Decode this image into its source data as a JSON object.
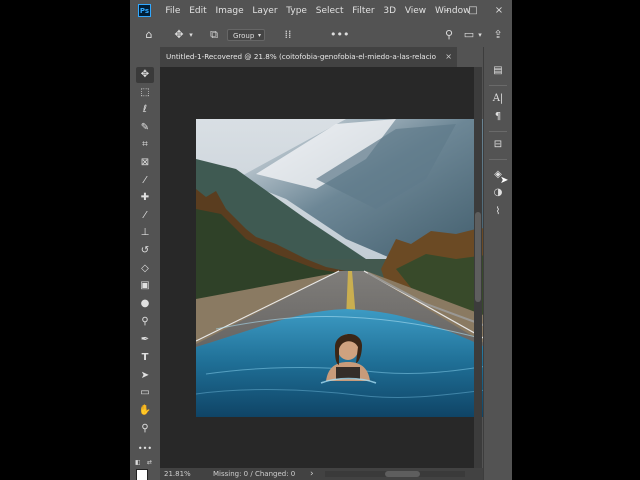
{
  "app": {
    "logo_text": "Ps",
    "menus": [
      "File",
      "Edit",
      "Image",
      "Layer",
      "Type",
      "Select",
      "Filter",
      "3D",
      "View",
      "Window"
    ],
    "window_controls": {
      "minimize": "–",
      "maximize": "□",
      "close": "×"
    }
  },
  "options_bar": {
    "auto_select_value": "Group",
    "icons": [
      "home-icon",
      "move-icon",
      "chevron-down-icon",
      "layer-stack-icon",
      "align-icon",
      "more-icon",
      "search-icon",
      "workspace-icon",
      "share-icon"
    ]
  },
  "document": {
    "tab_title": "Untitled-1-Recovered @ 21.8% (coitofobia-genofobia-el-miedo-a-las-relacio...",
    "tab_close": "×",
    "photo_description_icon": "photo-canvas"
  },
  "status_bar": {
    "zoom": "21.81%",
    "info": "Missing: 0 / Changed: 0",
    "arrow": "›"
  },
  "tools": [
    {
      "name": "move-tool-icon",
      "glyph": "✥"
    },
    {
      "name": "marquee-tool-icon",
      "glyph": "⬚"
    },
    {
      "name": "lasso-tool-icon",
      "glyph": "ℓ"
    },
    {
      "name": "quick-select-tool-icon",
      "glyph": "✎"
    },
    {
      "name": "crop-tool-icon",
      "glyph": "⌗"
    },
    {
      "name": "frame-tool-icon",
      "glyph": "⊠"
    },
    {
      "name": "eyedropper-tool-icon",
      "glyph": "⁄"
    },
    {
      "name": "healing-brush-tool-icon",
      "glyph": "✚"
    },
    {
      "name": "brush-tool-icon",
      "glyph": "⁄"
    },
    {
      "name": "clone-stamp-tool-icon",
      "glyph": "⊥"
    },
    {
      "name": "history-brush-tool-icon",
      "glyph": "↺"
    },
    {
      "name": "eraser-tool-icon",
      "glyph": "◇"
    },
    {
      "name": "gradient-tool-icon",
      "glyph": "▣"
    },
    {
      "name": "blur-tool-icon",
      "glyph": "●"
    },
    {
      "name": "dodge-tool-icon",
      "glyph": "⚲"
    },
    {
      "name": "pen-tool-icon",
      "glyph": "✒"
    },
    {
      "name": "type-tool-icon",
      "glyph": "T"
    },
    {
      "name": "path-select-tool-icon",
      "glyph": "➤"
    },
    {
      "name": "rectangle-tool-icon",
      "glyph": "▭"
    },
    {
      "name": "hand-tool-icon",
      "glyph": "✋"
    },
    {
      "name": "zoom-tool-icon",
      "glyph": "⚲"
    },
    {
      "name": "edit-toolbar-icon",
      "glyph": "•••"
    }
  ],
  "right_panel": [
    {
      "name": "libraries-icon",
      "glyph": "▤"
    },
    {
      "name": "character-icon",
      "glyph": "A|"
    },
    {
      "name": "paragraph-icon",
      "glyph": "¶"
    },
    {
      "name": "properties-icon",
      "glyph": "⊟"
    },
    {
      "name": "layers-icon",
      "glyph": "◈"
    },
    {
      "name": "channels-icon",
      "glyph": "◑"
    },
    {
      "name": "paths-icon",
      "glyph": "⌇"
    }
  ],
  "colors": {
    "ui_bg": "#535353",
    "canvas_bg": "#282828",
    "tab_bg": "#424242",
    "accent_logo": "#31a8ff"
  }
}
